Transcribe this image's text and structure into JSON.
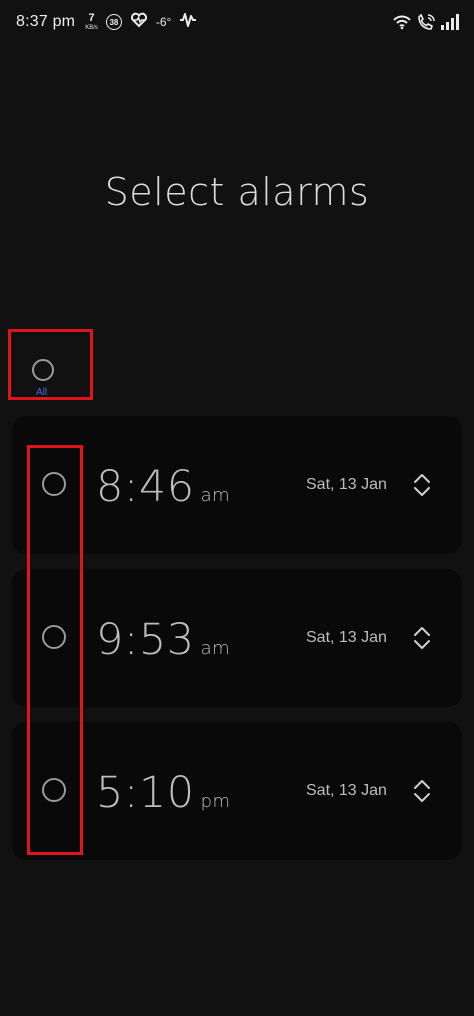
{
  "status_bar": {
    "time": "8:37 pm",
    "net_speed_value": "7",
    "net_speed_unit": "KB/s",
    "badge": "38",
    "temperature": "-6°",
    "icons": [
      "heart-rate-icon",
      "pulse-icon",
      "wifi-icon",
      "wifi-call-icon",
      "signal-icon"
    ]
  },
  "title": "Select alarms",
  "select_all": {
    "label": "All",
    "label_color": "#3b6fe0",
    "checked": false
  },
  "alarms": [
    {
      "time": "8:46",
      "ampm": "am",
      "date": "Sat, 13 Jan",
      "checked": false
    },
    {
      "time": "9:53",
      "ampm": "am",
      "date": "Sat, 13 Jan",
      "checked": false
    },
    {
      "time": "5:10",
      "ampm": "pm",
      "date": "Sat, 13 Jan",
      "checked": false
    }
  ],
  "colors": {
    "background": "#111111",
    "card": "#090909",
    "highlight": "#e0141b"
  }
}
